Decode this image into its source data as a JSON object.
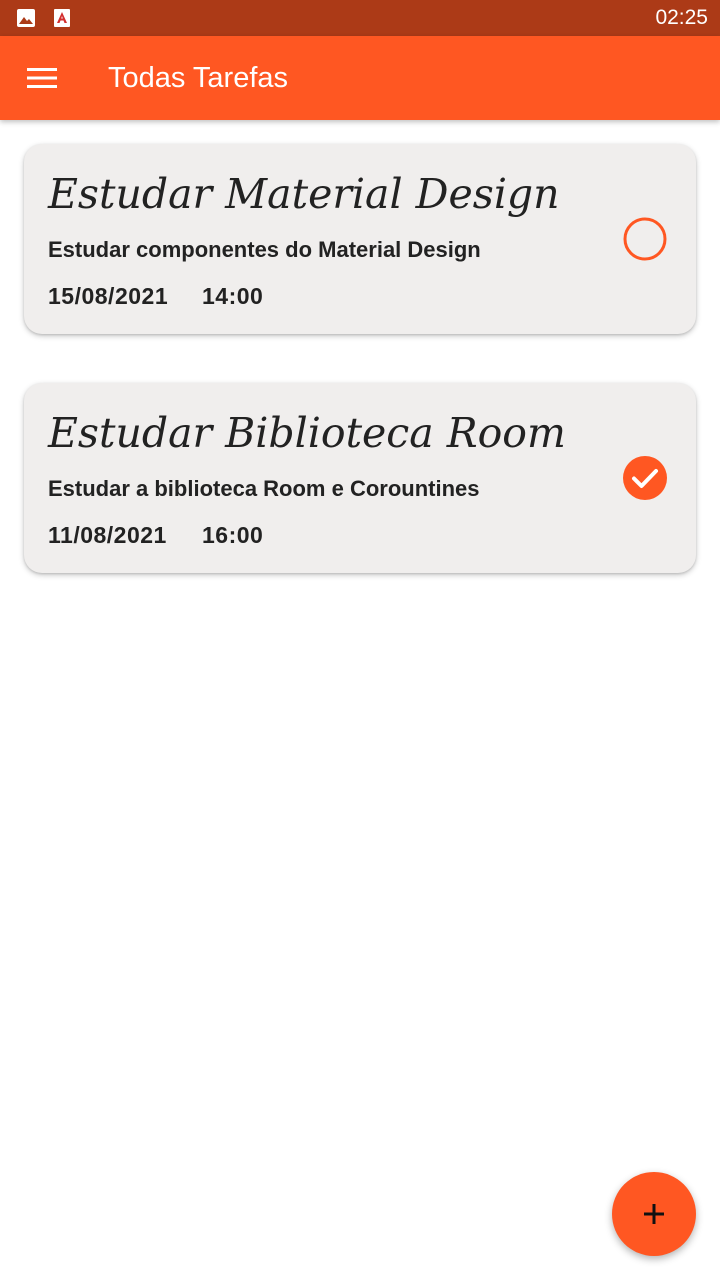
{
  "status_bar": {
    "time": "02:25",
    "icons": [
      "image-icon",
      "pdf-app-icon"
    ]
  },
  "app_bar": {
    "title": "Todas Tarefas",
    "menu_icon": "hamburger-menu-icon",
    "color": "#ff5722"
  },
  "tasks": [
    {
      "title": "Estudar Material Design",
      "description": "Estudar componentes do Material Design",
      "date": "15/08/2021",
      "time": "14:00",
      "completed": false
    },
    {
      "title": "Estudar Biblioteca Room",
      "description": "Estudar a biblioteca Room e Corountines",
      "date": "11/08/2021",
      "time": "16:00",
      "completed": true
    }
  ],
  "fab": {
    "icon": "plus-icon",
    "color": "#ff5722"
  },
  "colors": {
    "accent": "#ff5722",
    "status_bar": "#ac3a17",
    "card_background": "#f0eeed"
  }
}
